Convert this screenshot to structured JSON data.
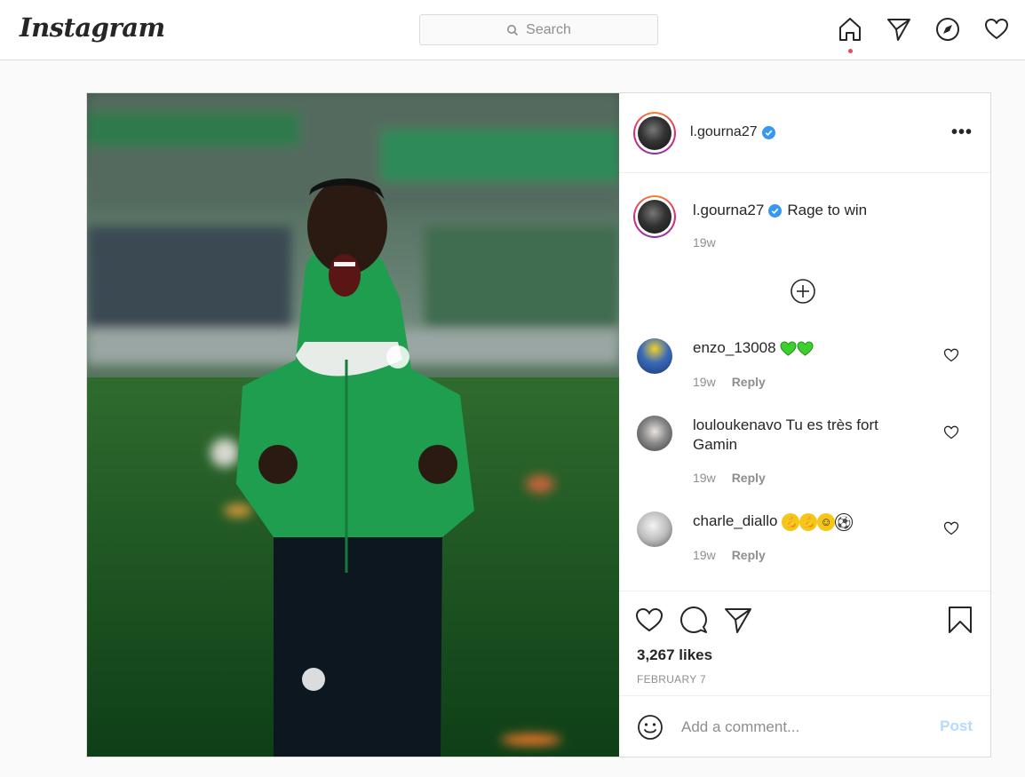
{
  "header": {
    "logo": "Instagram",
    "search_placeholder": "Search",
    "nav": [
      "home-icon",
      "direct-icon",
      "explore-icon",
      "activity-icon"
    ]
  },
  "post": {
    "username": "l.gourna27",
    "caption": "Rage to win",
    "caption_time": "19w",
    "likes": "3,267 likes",
    "date": "FEBRUARY 7",
    "comment_placeholder": "Add a comment...",
    "post_label": "Post"
  },
  "comments": [
    {
      "username": "enzo_13008",
      "text": "",
      "emoji": [
        "green-heart",
        "green-heart"
      ],
      "time": "19w",
      "reply": "Reply"
    },
    {
      "username": "louloukenavo",
      "text": "Tu es très fort Gamin",
      "emoji": [],
      "time": "19w",
      "reply": "Reply"
    },
    {
      "username": "charle_diallo",
      "text": "",
      "emoji": [
        "flexed-biceps",
        "flexed-biceps",
        "smiling-face-with-halo",
        "soccer-ball"
      ],
      "time": "19w",
      "reply": "Reply"
    }
  ],
  "colors": {
    "verified": "#3897f0",
    "notification_dot": "#ed4956",
    "post_button": "#b3dbff",
    "jacket_green": "#1e9e4e"
  }
}
